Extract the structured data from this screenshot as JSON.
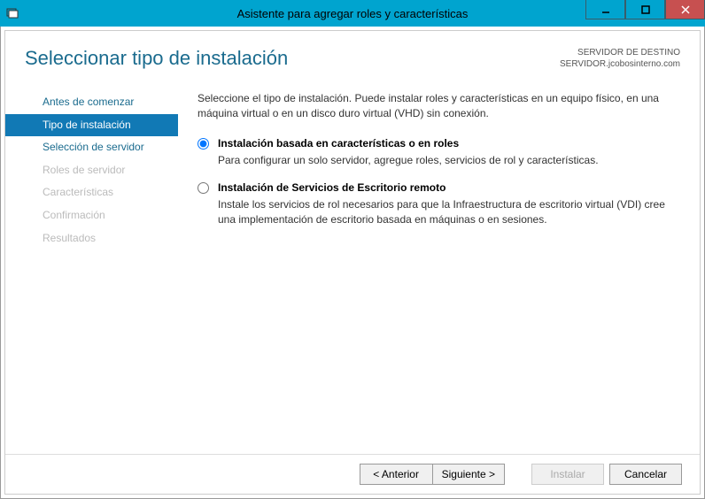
{
  "titlebar": {
    "title": "Asistente para agregar roles y características"
  },
  "header": {
    "page_title": "Seleccionar tipo de instalación",
    "dest_label": "SERVIDOR DE DESTINO",
    "dest_name": "SERVIDOR.jcobosinterno.com"
  },
  "sidebar": {
    "items": [
      {
        "label": "Antes de comenzar",
        "state": "normal"
      },
      {
        "label": "Tipo de instalación",
        "state": "active"
      },
      {
        "label": "Selección de servidor",
        "state": "normal"
      },
      {
        "label": "Roles de servidor",
        "state": "disabled"
      },
      {
        "label": "Características",
        "state": "disabled"
      },
      {
        "label": "Confirmación",
        "state": "disabled"
      },
      {
        "label": "Resultados",
        "state": "disabled"
      }
    ]
  },
  "main": {
    "intro": "Seleccione el tipo de instalación. Puede instalar roles y características en un equipo físico, en una máquina virtual o en un disco duro virtual (VHD) sin conexión.",
    "options": [
      {
        "title": "Instalación basada en características o en roles",
        "desc": "Para configurar un solo servidor, agregue roles, servicios de rol y características.",
        "selected": true
      },
      {
        "title": "Instalación de Servicios de Escritorio remoto",
        "desc": "Instale los servicios de rol necesarios para que la Infraestructura de escritorio virtual (VDI) cree una implementación de escritorio basada en máquinas o en sesiones.",
        "selected": false
      }
    ]
  },
  "footer": {
    "prev": "< Anterior",
    "next": "Siguiente >",
    "install": "Instalar",
    "cancel": "Cancelar"
  }
}
